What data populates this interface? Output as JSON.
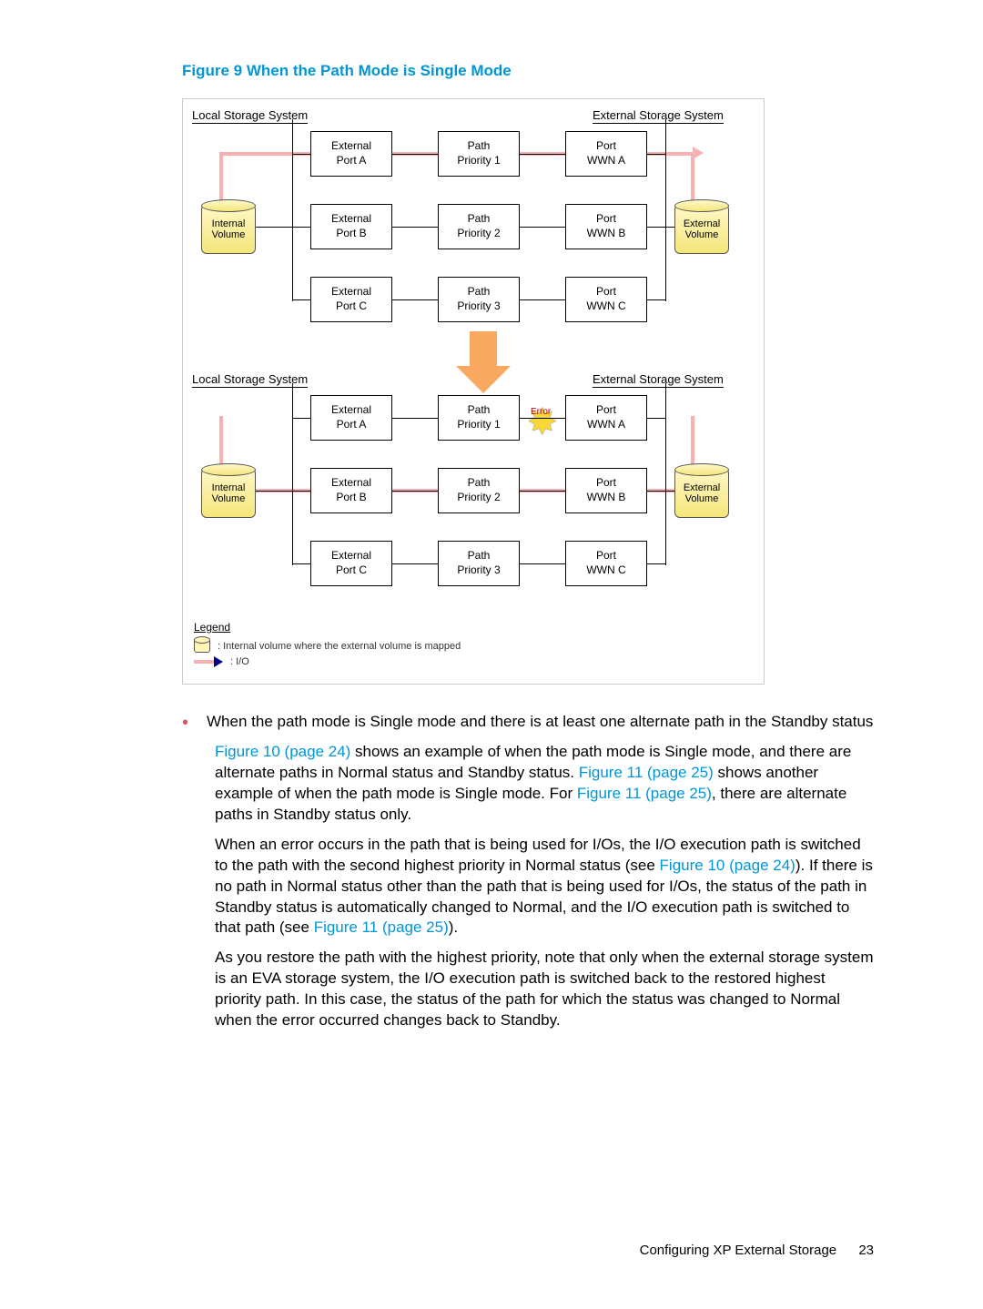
{
  "figure": {
    "caption": "Figure 9 When the Path Mode is Single Mode",
    "local_label": "Local Storage System",
    "external_label": "External Storage System",
    "row1": {
      "ext": "External",
      "porta": "Port A",
      "path": "Path",
      "pri": "Priority 1",
      "port": "Port",
      "wwn": "WWN A"
    },
    "row2": {
      "ext": "External",
      "portb": "Port B",
      "path": "Path",
      "pri": "Priority 2",
      "port": "Port",
      "wwn": "WWN B"
    },
    "row3": {
      "ext": "External",
      "portc": "Port C",
      "path": "Path",
      "pri": "Priority 3",
      "port": "Port",
      "wwn": "WWN C"
    },
    "internal_vol_l1": "Internal",
    "internal_vol_l2": "Volume",
    "external_vol_l1": "External",
    "external_vol_l2": "Volume",
    "error_label": "Error",
    "legend_title": "Legend",
    "legend_vol": ": Internal volume where the external volume is mapped",
    "legend_io": ": I/O"
  },
  "body": {
    "bullet": "When the path mode is Single mode and there is at least one alternate path in the Standby status",
    "p1_a": "Figure 10 (page 24)",
    "p1_b": " shows an example of when the path mode is Single mode, and there are alternate paths in Normal status and Standby status. ",
    "p1_c": "Figure 11 (page 25)",
    "p1_d": " shows another example of when the path mode is Single mode. For ",
    "p1_e": "Figure 11 (page 25)",
    "p1_f": ", there are alternate paths in Standby status only.",
    "p2_a": "When an error occurs in the path that is being used for I/Os, the I/O execution path is switched to the path with the second highest priority in Normal status (see ",
    "p2_b": "Figure 10 (page 24)",
    "p2_c": "). If there is no path in Normal status other than the path that is being used for I/Os, the status of the path in Standby status is automatically changed to Normal, and the I/O execution path is switched to that path (see ",
    "p2_d": "Figure 11 (page 25)",
    "p2_e": ").",
    "p3": "As you restore the path with the highest priority, note that only when the external storage system is an EVA storage system, the I/O execution path is switched back to the restored highest priority path. In this case, the status of the path for which the status was changed to Normal when the error occurred changes back to Standby."
  },
  "footer": {
    "text": "Configuring XP External Storage",
    "page": "23"
  }
}
